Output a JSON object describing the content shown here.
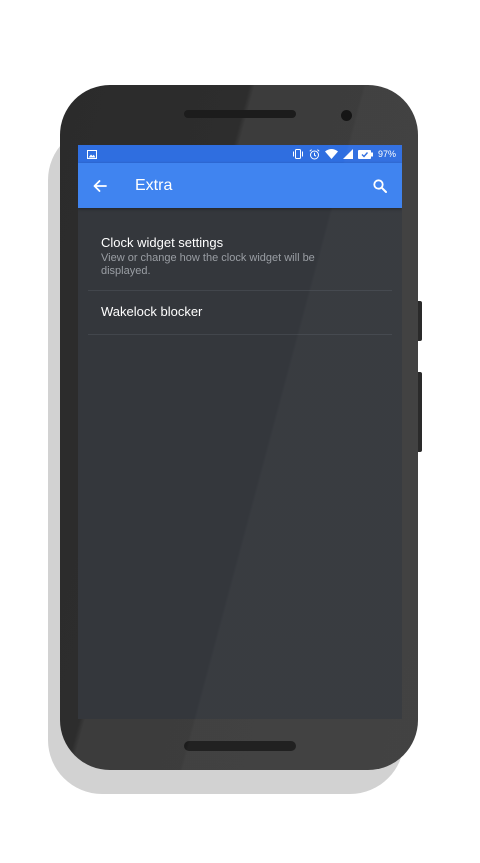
{
  "status_bar": {
    "battery_percent": "97%",
    "icons": [
      "image-notification-icon",
      "vibrate-icon",
      "alarm-icon",
      "wifi-icon",
      "cell-signal-icon",
      "battery-icon"
    ]
  },
  "app_bar": {
    "title": "Extra",
    "back_icon": "arrow-back-icon",
    "search_icon": "search-icon"
  },
  "settings": [
    {
      "title": "Clock widget settings",
      "summary": "View or change how the clock widget will be displayed."
    },
    {
      "title": "Wakelock blocker"
    }
  ],
  "colors": {
    "status_bar": "#2f6ee0",
    "app_bar": "#4084f0",
    "background": "#34373c"
  }
}
